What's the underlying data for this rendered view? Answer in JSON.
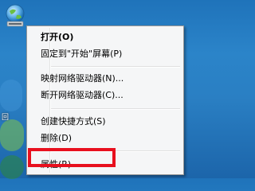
{
  "desktop": {
    "icon_name": "network-icon",
    "edge_label": "回"
  },
  "context_menu": {
    "items": [
      {
        "label": "打开(O)",
        "bold": true
      },
      {
        "label": "固定到\"开始\"屏幕(P)"
      },
      {
        "label": "映射网络驱动器(N)..."
      },
      {
        "label": "断开网络驱动器(C)..."
      },
      {
        "label": "创建快捷方式(S)"
      },
      {
        "label": "删除(D)"
      },
      {
        "label": "属性(R)"
      }
    ]
  },
  "annotation": {
    "highlight_color": "#e8101e",
    "highlighted_item": "属性(R)"
  }
}
